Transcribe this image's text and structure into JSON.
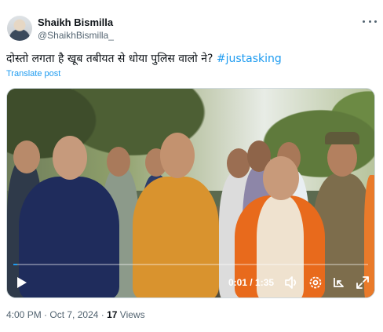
{
  "author": {
    "display_name": "Shaikh Bismilla",
    "handle": "@ShaikhBismilla_"
  },
  "tweet": {
    "text": "दोस्तो लगता है खूब तबीयत से धोया पुलिस वालो ने? ",
    "hashtag": "#justasking",
    "translate_label": "Translate post"
  },
  "video": {
    "time_display": "0:01 / 1:35",
    "progress": 0.01
  },
  "meta": {
    "time": "4:00 PM",
    "separator": " · ",
    "date": "Oct 7, 2024",
    "views_count": "17",
    "views_label": " Views"
  },
  "icons": {
    "more": "more-horizontal-icon",
    "play": "play-icon",
    "volume": "volume-icon",
    "settings": "gear-icon",
    "pip": "picture-in-picture-icon",
    "fullscreen": "fullscreen-icon"
  },
  "colors": {
    "accent": "#1d9bf0",
    "text_primary": "#0f1419",
    "text_secondary": "#536471"
  }
}
